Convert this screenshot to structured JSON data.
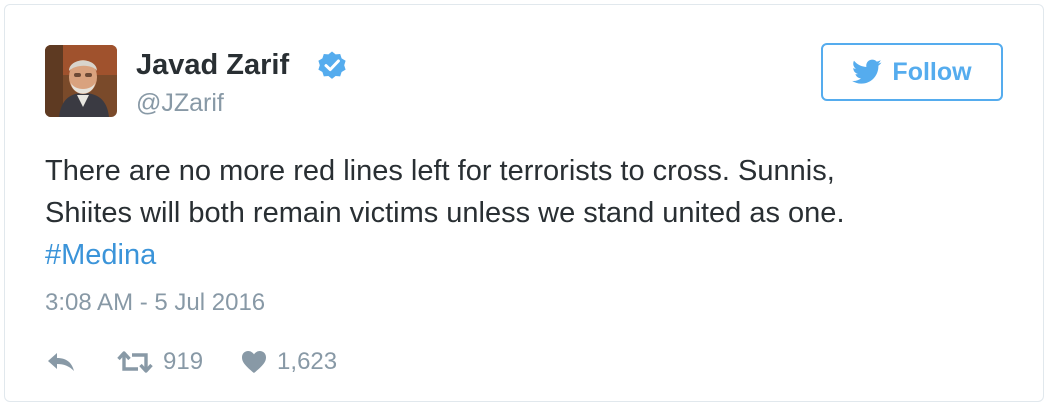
{
  "tweet": {
    "author": {
      "display_name": "Javad Zarif",
      "handle": "@JZarif",
      "verified": true
    },
    "follow_label": "Follow",
    "text_line_1": "There are no more red lines left for terrorists to cross. Sunnis,",
    "text_line_2": "Shiites will both remain victims unless we stand united as one.",
    "hashtag": "#Medina",
    "timestamp": "3:08 AM - 5 Jul 2016",
    "retweet_count": "919",
    "like_count": "1,623"
  },
  "colors": {
    "accent": "#55acee",
    "link": "#3b94d9",
    "text": "#292f33",
    "muted": "#8899a6"
  },
  "icons": [
    "verified-badge-icon",
    "twitter-bird-icon",
    "reply-icon",
    "retweet-icon",
    "heart-icon"
  ]
}
